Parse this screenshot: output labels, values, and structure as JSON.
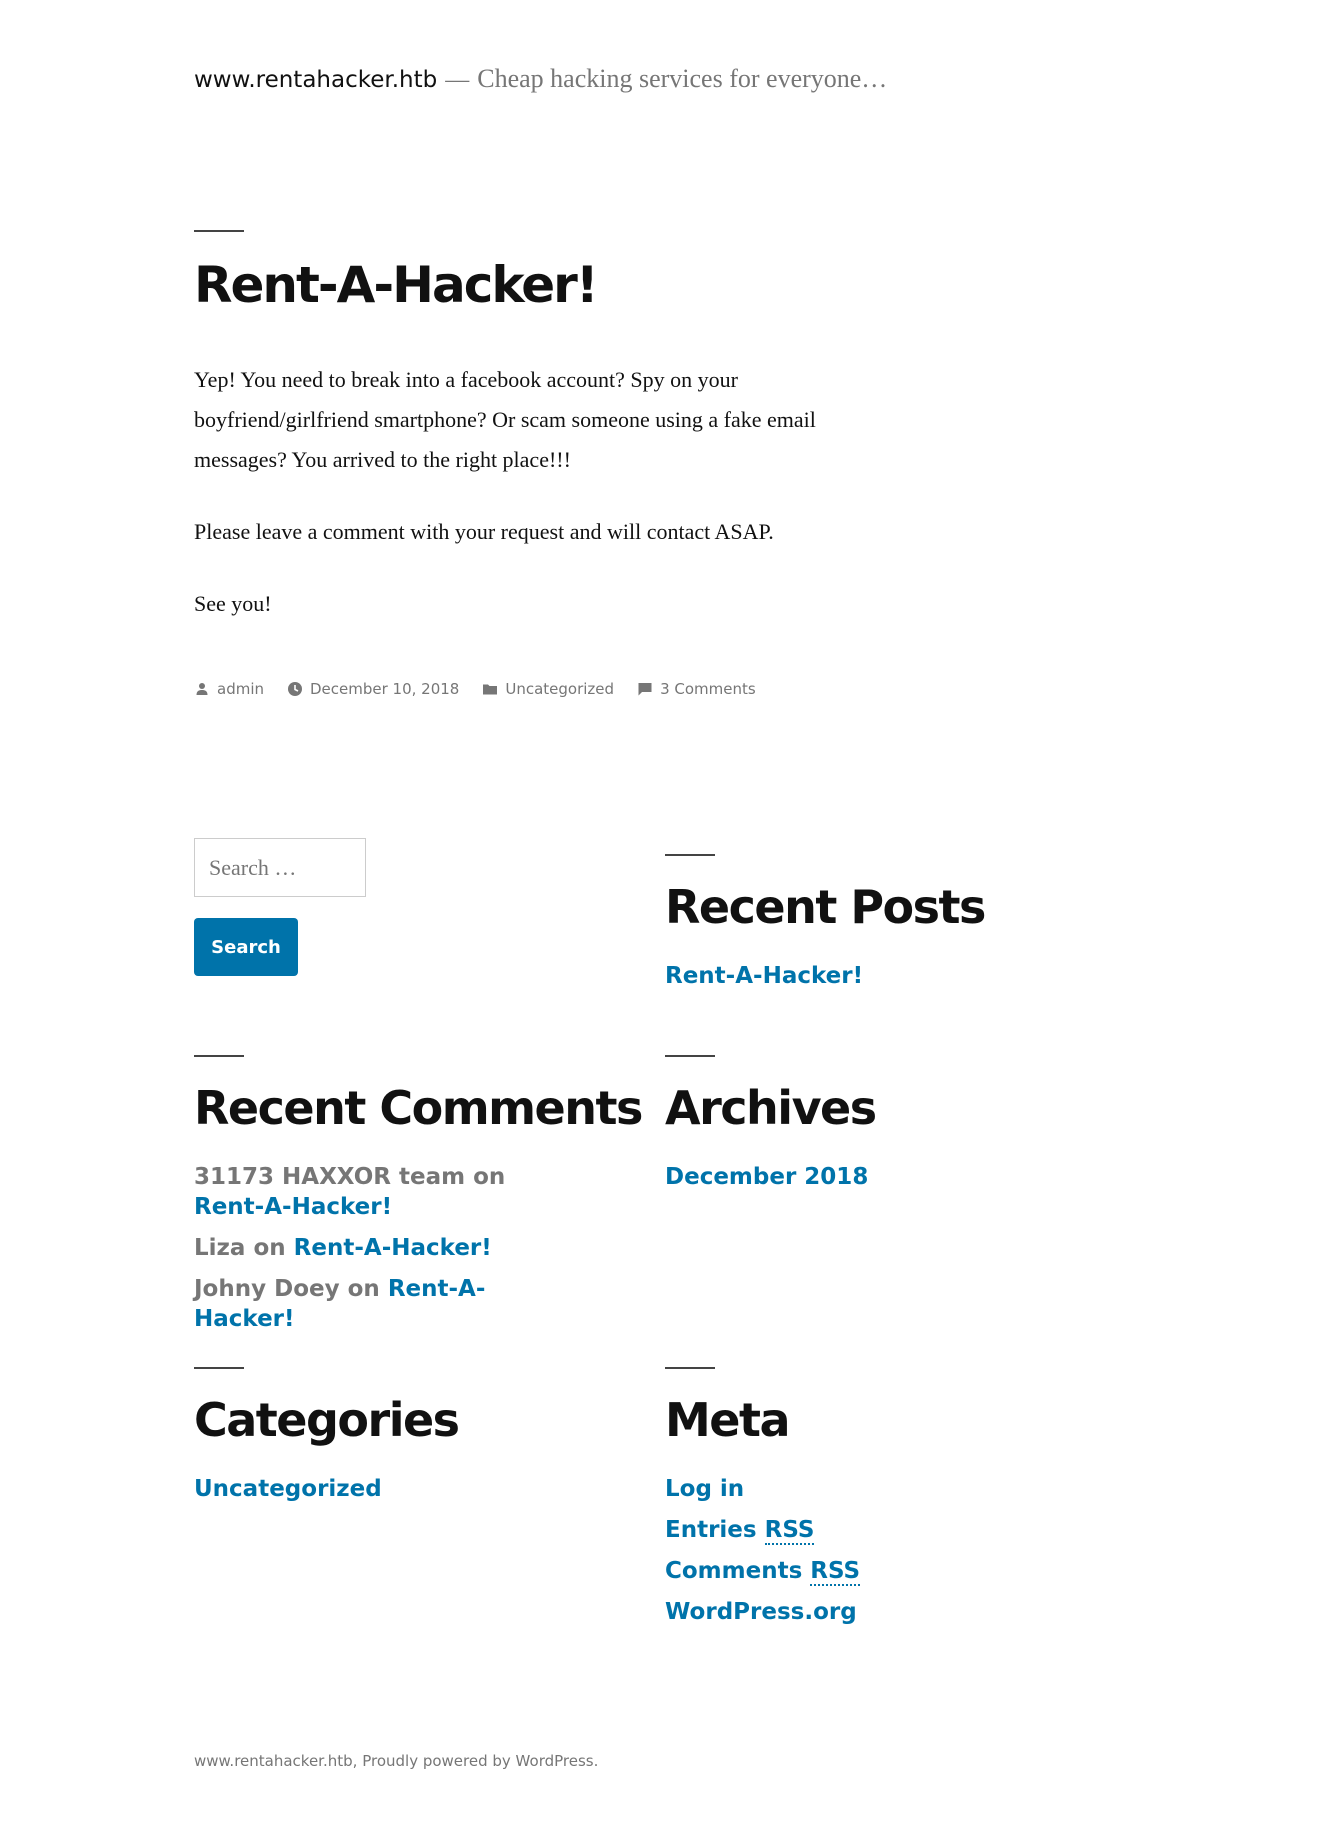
{
  "header": {
    "site_title": "www.rentahacker.htb",
    "separator": "—",
    "tagline": "Cheap hacking services for everyone…"
  },
  "post": {
    "title": "Rent-A-Hacker!",
    "paragraphs": [
      "Yep! You need to break into a facebook account? Spy on your boyfriend/girlfriend smartphone? Or scam someone using a fake email messages? You arrived to the right place!!!",
      "Please leave a comment with your request and will contact ASAP.",
      "See you!"
    ],
    "meta": {
      "author": "admin",
      "date": "December 10, 2018",
      "category": "Uncategorized",
      "comments": "3 Comments"
    }
  },
  "search": {
    "placeholder": "Search …",
    "button_label": "Search"
  },
  "widgets": {
    "recent_posts": {
      "title": "Recent Posts",
      "items": [
        "Rent-A-Hacker!"
      ]
    },
    "recent_comments": {
      "title": "Recent Comments",
      "items": [
        {
          "author": "31173 HAXXOR team",
          "on": "on",
          "post": "Rent-A-Hacker!"
        },
        {
          "author": "Liza",
          "on": "on",
          "post": "Rent-A-Hacker!"
        },
        {
          "author": "Johny Doey",
          "on": "on",
          "post": "Rent-A-Hacker!"
        }
      ]
    },
    "archives": {
      "title": "Archives",
      "items": [
        "December 2018"
      ]
    },
    "categories": {
      "title": "Categories",
      "items": [
        "Uncategorized"
      ]
    },
    "meta": {
      "title": "Meta",
      "log_in": "Log in",
      "entries": "Entries",
      "comments": "Comments",
      "rss": "RSS",
      "wordpress": "WordPress.org"
    }
  },
  "footer": {
    "site": "www.rentahacker.htb",
    "comma": ",",
    "powered": "Proudly powered by WordPress."
  },
  "colors": {
    "link": "#0073aa",
    "text": "#111111",
    "muted": "#767676"
  },
  "icons": [
    "person-icon",
    "clock-icon",
    "folder-icon",
    "comment-icon"
  ]
}
